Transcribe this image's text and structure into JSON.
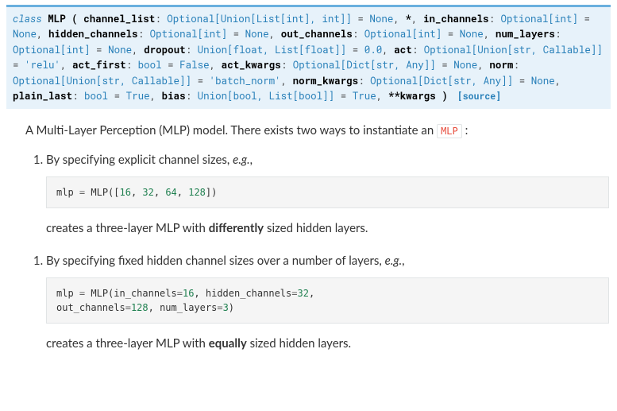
{
  "signature": {
    "class_keyword": "class",
    "class_name": "MLP",
    "open": "(",
    "close": ")",
    "source_label": "[source]",
    "params": [
      {
        "name": "channel_list",
        "type": "Optional[Union[List[int], int]]",
        "default": "None"
      },
      {
        "name": "*",
        "type": "",
        "default": ""
      },
      {
        "name": "in_channels",
        "type": "Optional[int]",
        "default": "None"
      },
      {
        "name": "hidden_channels",
        "type": "Optional[int]",
        "default": "None"
      },
      {
        "name": "out_channels",
        "type": "Optional[int]",
        "default": "None"
      },
      {
        "name": "num_layers",
        "type": "Optional[int]",
        "default": "None"
      },
      {
        "name": "dropout",
        "type": "Union[float, List[float]]",
        "default": "0.0"
      },
      {
        "name": "act",
        "type": "Optional[Union[str, Callable]]",
        "default": "'relu'"
      },
      {
        "name": "act_first",
        "type": "bool",
        "default": "False"
      },
      {
        "name": "act_kwargs",
        "type": "Optional[Dict[str, Any]]",
        "default": "None"
      },
      {
        "name": "norm",
        "type": "Optional[Union[str, Callable]]",
        "default": "'batch_norm'"
      },
      {
        "name": "norm_kwargs",
        "type": "Optional[Dict[str, Any]]",
        "default": "None"
      },
      {
        "name": "plain_last",
        "type": "bool",
        "default": "True"
      },
      {
        "name": "bias",
        "type": "Union[bool, List[bool]]",
        "default": "True"
      },
      {
        "name": "**kwargs",
        "type": "",
        "default": ""
      }
    ]
  },
  "body": {
    "intro_pre": "A Multi-Layer Perception (MLP) model. There exists two ways to instantiate an ",
    "intro_code": "MLP",
    "intro_post": " :",
    "items": [
      {
        "marker": "1.",
        "lead_pre": "By specifying explicit channel sizes, ",
        "lead_em": "e.g.",
        "lead_post": ",",
        "code_lines": [
          [
            {
              "cls": "n",
              "t": "mlp "
            },
            {
              "cls": "o",
              "t": "="
            },
            {
              "cls": "n",
              "t": " MLP(["
            },
            {
              "cls": "mi",
              "t": "16"
            },
            {
              "cls": "n",
              "t": ", "
            },
            {
              "cls": "mi",
              "t": "32"
            },
            {
              "cls": "n",
              "t": ", "
            },
            {
              "cls": "mi",
              "t": "64"
            },
            {
              "cls": "n",
              "t": ", "
            },
            {
              "cls": "mi",
              "t": "128"
            },
            {
              "cls": "n",
              "t": "])"
            }
          ]
        ],
        "after_pre": "creates a three-layer MLP with ",
        "after_strong": "differently",
        "after_post": " sized hidden layers."
      },
      {
        "marker": "1.",
        "lead_pre": "By specifying fixed hidden channel sizes over a number of layers, ",
        "lead_em": "e.g.",
        "lead_post": ",",
        "code_lines": [
          [
            {
              "cls": "n",
              "t": "mlp "
            },
            {
              "cls": "o",
              "t": "="
            },
            {
              "cls": "n",
              "t": " MLP(in_channels"
            },
            {
              "cls": "o",
              "t": "="
            },
            {
              "cls": "mi",
              "t": "16"
            },
            {
              "cls": "n",
              "t": ", hidden_channels"
            },
            {
              "cls": "o",
              "t": "="
            },
            {
              "cls": "mi",
              "t": "32"
            },
            {
              "cls": "n",
              "t": ","
            }
          ],
          [
            {
              "cls": "n",
              "t": "          out_channels"
            },
            {
              "cls": "o",
              "t": "="
            },
            {
              "cls": "mi",
              "t": "128"
            },
            {
              "cls": "n",
              "t": ", num_layers"
            },
            {
              "cls": "o",
              "t": "="
            },
            {
              "cls": "mi",
              "t": "3"
            },
            {
              "cls": "n",
              "t": ")"
            }
          ]
        ],
        "after_pre": "creates a three-layer MLP with ",
        "after_strong": "equally",
        "after_post": " sized hidden layers."
      }
    ]
  }
}
